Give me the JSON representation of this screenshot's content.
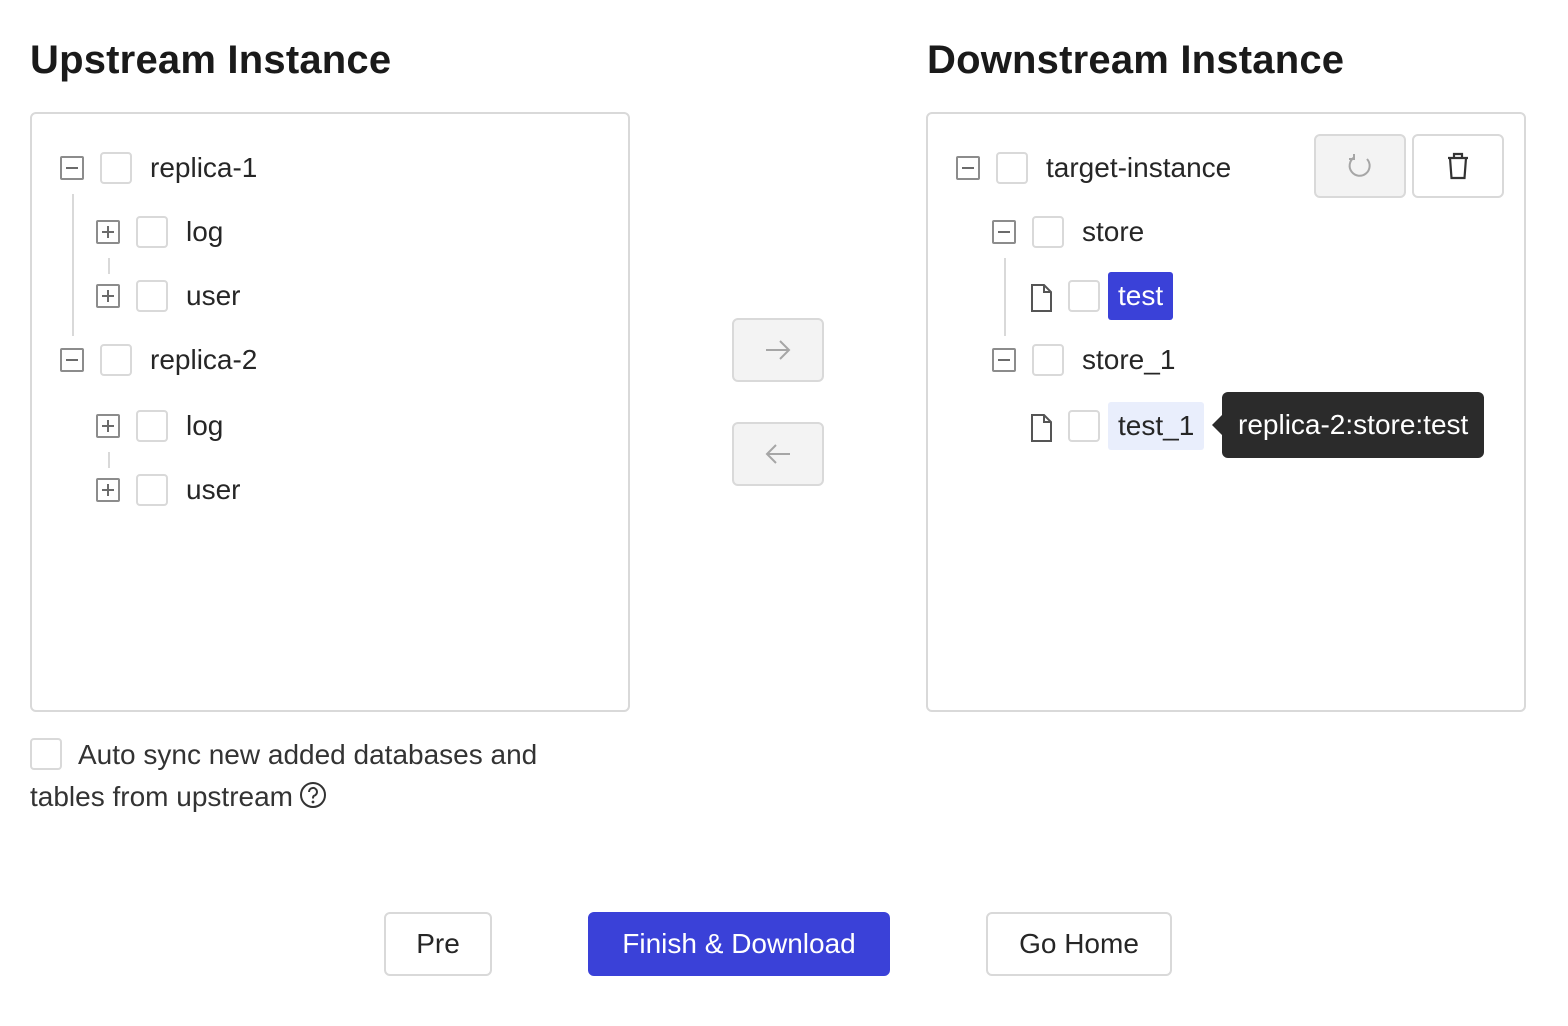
{
  "upstream": {
    "title": "Upstream Instance",
    "nodes": [
      {
        "label": "replica-1",
        "expanded": true,
        "children": [
          {
            "label": "log",
            "expanded": false
          },
          {
            "label": "user",
            "expanded": false
          }
        ]
      },
      {
        "label": "replica-2",
        "expanded": true,
        "children": [
          {
            "label": "log",
            "expanded": false
          },
          {
            "label": "user",
            "expanded": false
          }
        ]
      }
    ]
  },
  "downstream": {
    "title": "Downstream Instance",
    "root": {
      "label": "target-instance",
      "children": [
        {
          "label": "store",
          "children": [
            {
              "label": "test",
              "highlight": "selected"
            }
          ]
        },
        {
          "label": "store_1",
          "children": [
            {
              "label": "test_1",
              "highlight": "hover"
            }
          ]
        }
      ]
    },
    "tooltip": "replica-2:store:test"
  },
  "transfer": {
    "move_right_icon": "arrow-right-icon",
    "move_left_icon": "arrow-left-icon"
  },
  "toolbar": {
    "refresh_icon": "refresh-icon",
    "delete_icon": "trash-icon"
  },
  "options": {
    "auto_sync_label": "Auto sync new added databases and tables from upstream",
    "help_icon": "question-circle-icon"
  },
  "footer": {
    "pre_label": "Pre",
    "finish_label": "Finish & Download",
    "home_label": "Go Home"
  },
  "colors": {
    "primary": "#3a41d8",
    "hover_bg": "#e9eefc",
    "tooltip_bg": "#2b2b2b"
  }
}
